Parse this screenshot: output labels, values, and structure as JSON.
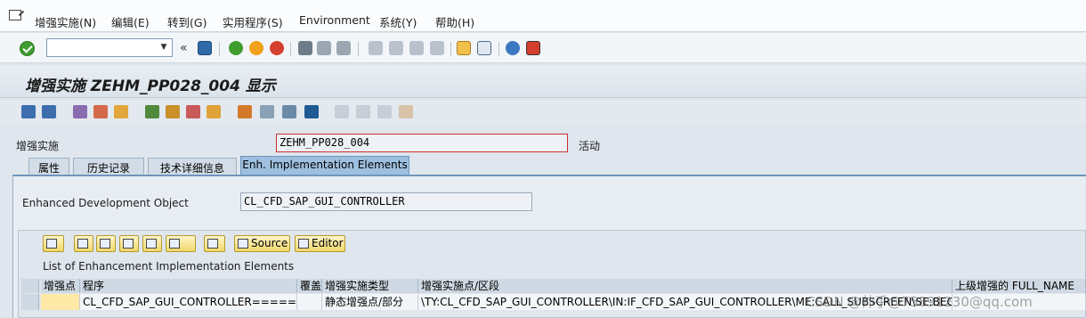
{
  "menu": {
    "items": [
      "增强实施(N)",
      "编辑(E)",
      "转到(G)",
      "实用程序(S)",
      "Environment",
      "系统(Y)",
      "帮助(H)"
    ]
  },
  "system_toolbar": {
    "command_field_value": "",
    "icons": [
      "enter-check-icon",
      "save-icon",
      "back-icon",
      "exit-icon",
      "cancel-icon",
      "print-icon",
      "find-icon",
      "find-next-icon",
      "first-page-icon",
      "prev-page-icon",
      "next-page-icon",
      "last-page-icon",
      "create-session-icon",
      "shortcut-icon",
      "help-icon",
      "customize-layout-icon"
    ]
  },
  "title": "增强实施 ZEHM_PP028_004 显示",
  "header": {
    "impl_label": "增强实施",
    "impl_value": "ZEHM_PP028_004",
    "status": "活动"
  },
  "tabs": [
    {
      "label": "属性",
      "active": false
    },
    {
      "label": "历史记录",
      "active": false
    },
    {
      "label": "技术详细信息",
      "active": false
    },
    {
      "label": "Enh. Implementation Elements",
      "active": true
    }
  ],
  "object": {
    "label": "Enhanced Development Object",
    "value": "CL_CFD_SAP_GUI_CONTROLLER"
  },
  "grid": {
    "buttons": {
      "source": "Source",
      "editor": "Editor"
    },
    "title": "List of Enhancement Implementation Elements",
    "columns": [
      "增强点",
      "程序",
      "覆盖",
      "增强实施类型",
      "增强实施点/区段",
      "上级增强的 FULL_NAME"
    ],
    "rows": [
      {
        "enh_point": "",
        "program": "CL_CFD_SAP_GUI_CONTROLLER=====CP",
        "overwrite": "",
        "impl_type": "静态增强点/部分",
        "impl_point": "\\TY:CL_CFD_SAP_GUI_CONTROLLER\\IN:IF_CFD_SAP_GUI_CONTROLLER\\ME:CALL_SUBSCREEN\\SE:BEGIN\\EI",
        "parent_full_name": ""
      }
    ]
  },
  "watermark": "CSDN @帅乎@7589123​0@qq.com",
  "colors": {
    "accent": "#6f95bb",
    "tab_active": "#9ec0e0",
    "required_border": "#c9302c",
    "highlight_cell": "#ffe9a6"
  }
}
